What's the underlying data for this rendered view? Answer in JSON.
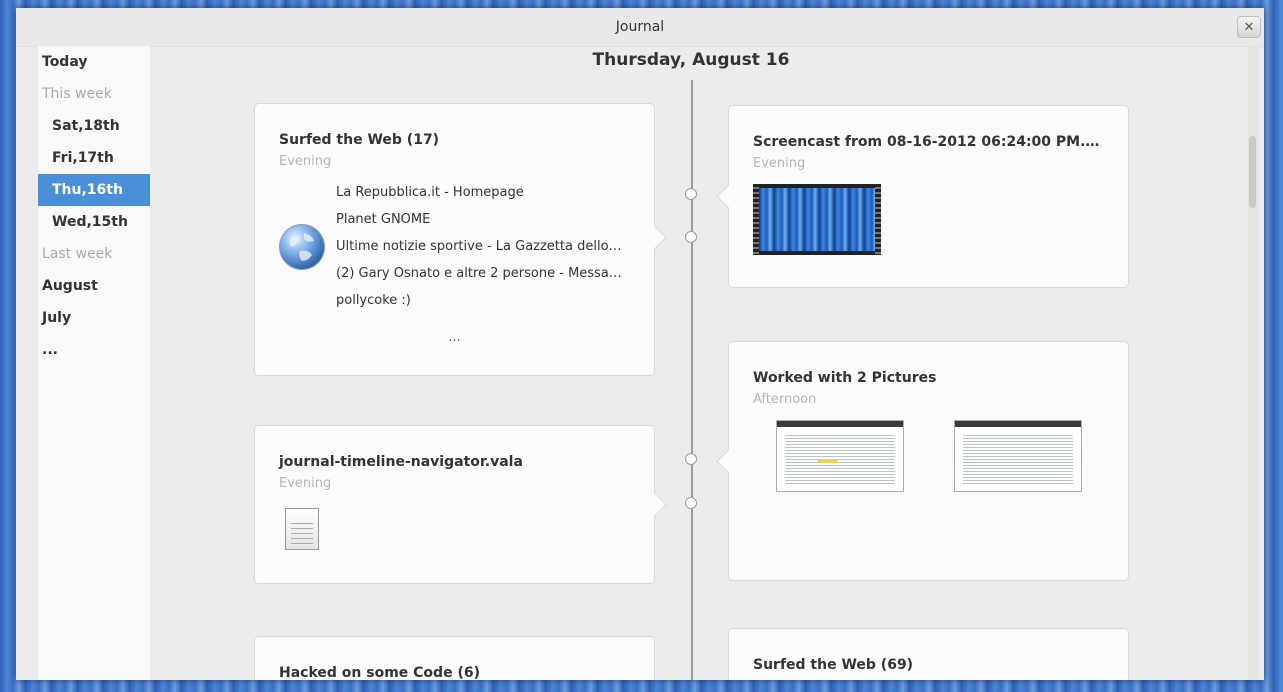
{
  "window": {
    "title": "Journal",
    "close_label": "✕"
  },
  "sidebar": {
    "items": [
      {
        "label": "Today",
        "kind": "top"
      },
      {
        "label": "This week",
        "kind": "header"
      },
      {
        "label": "Sat,18th",
        "kind": "day"
      },
      {
        "label": "Fri,17th",
        "kind": "day"
      },
      {
        "label": "Thu,16th",
        "kind": "day",
        "selected": true
      },
      {
        "label": "Wed,15th",
        "kind": "day"
      },
      {
        "label": "Last week",
        "kind": "header"
      },
      {
        "label": "August",
        "kind": "top"
      },
      {
        "label": "July",
        "kind": "top"
      },
      {
        "label": "...",
        "kind": "top"
      }
    ]
  },
  "main": {
    "date": "Thursday, August 16",
    "cards": {
      "web": {
        "title": "Surfed the Web (17)",
        "time": "Evening",
        "icon": "globe-icon",
        "links": [
          "La Repubblica.it - Homepage",
          "Planet GNOME",
          "Ultime notizie sportive - La Gazzetta dello…",
          "(2) Gary Osnato e altre 2 persone - Messa…",
          "pollycoke :)"
        ],
        "more": "..."
      },
      "screencast": {
        "title": "Screencast from 08-16-2012 06:24:00 PM.…",
        "time": "Evening",
        "icon": "video-thumbnail"
      },
      "file": {
        "title": "journal-timeline-navigator.vala",
        "time": "Evening",
        "icon": "text-file-icon"
      },
      "pictures": {
        "title": "Worked with 2 Pictures",
        "time": "Afternoon",
        "icon": "screenshot-thumbnail"
      },
      "code": {
        "title": "Hacked on some Code (6)"
      },
      "web2": {
        "title": "Surfed the Web (69)"
      }
    }
  },
  "colors": {
    "accent": "#4a90d9",
    "timeline": "#9b9b9b",
    "muted": "#b4b4b4"
  }
}
